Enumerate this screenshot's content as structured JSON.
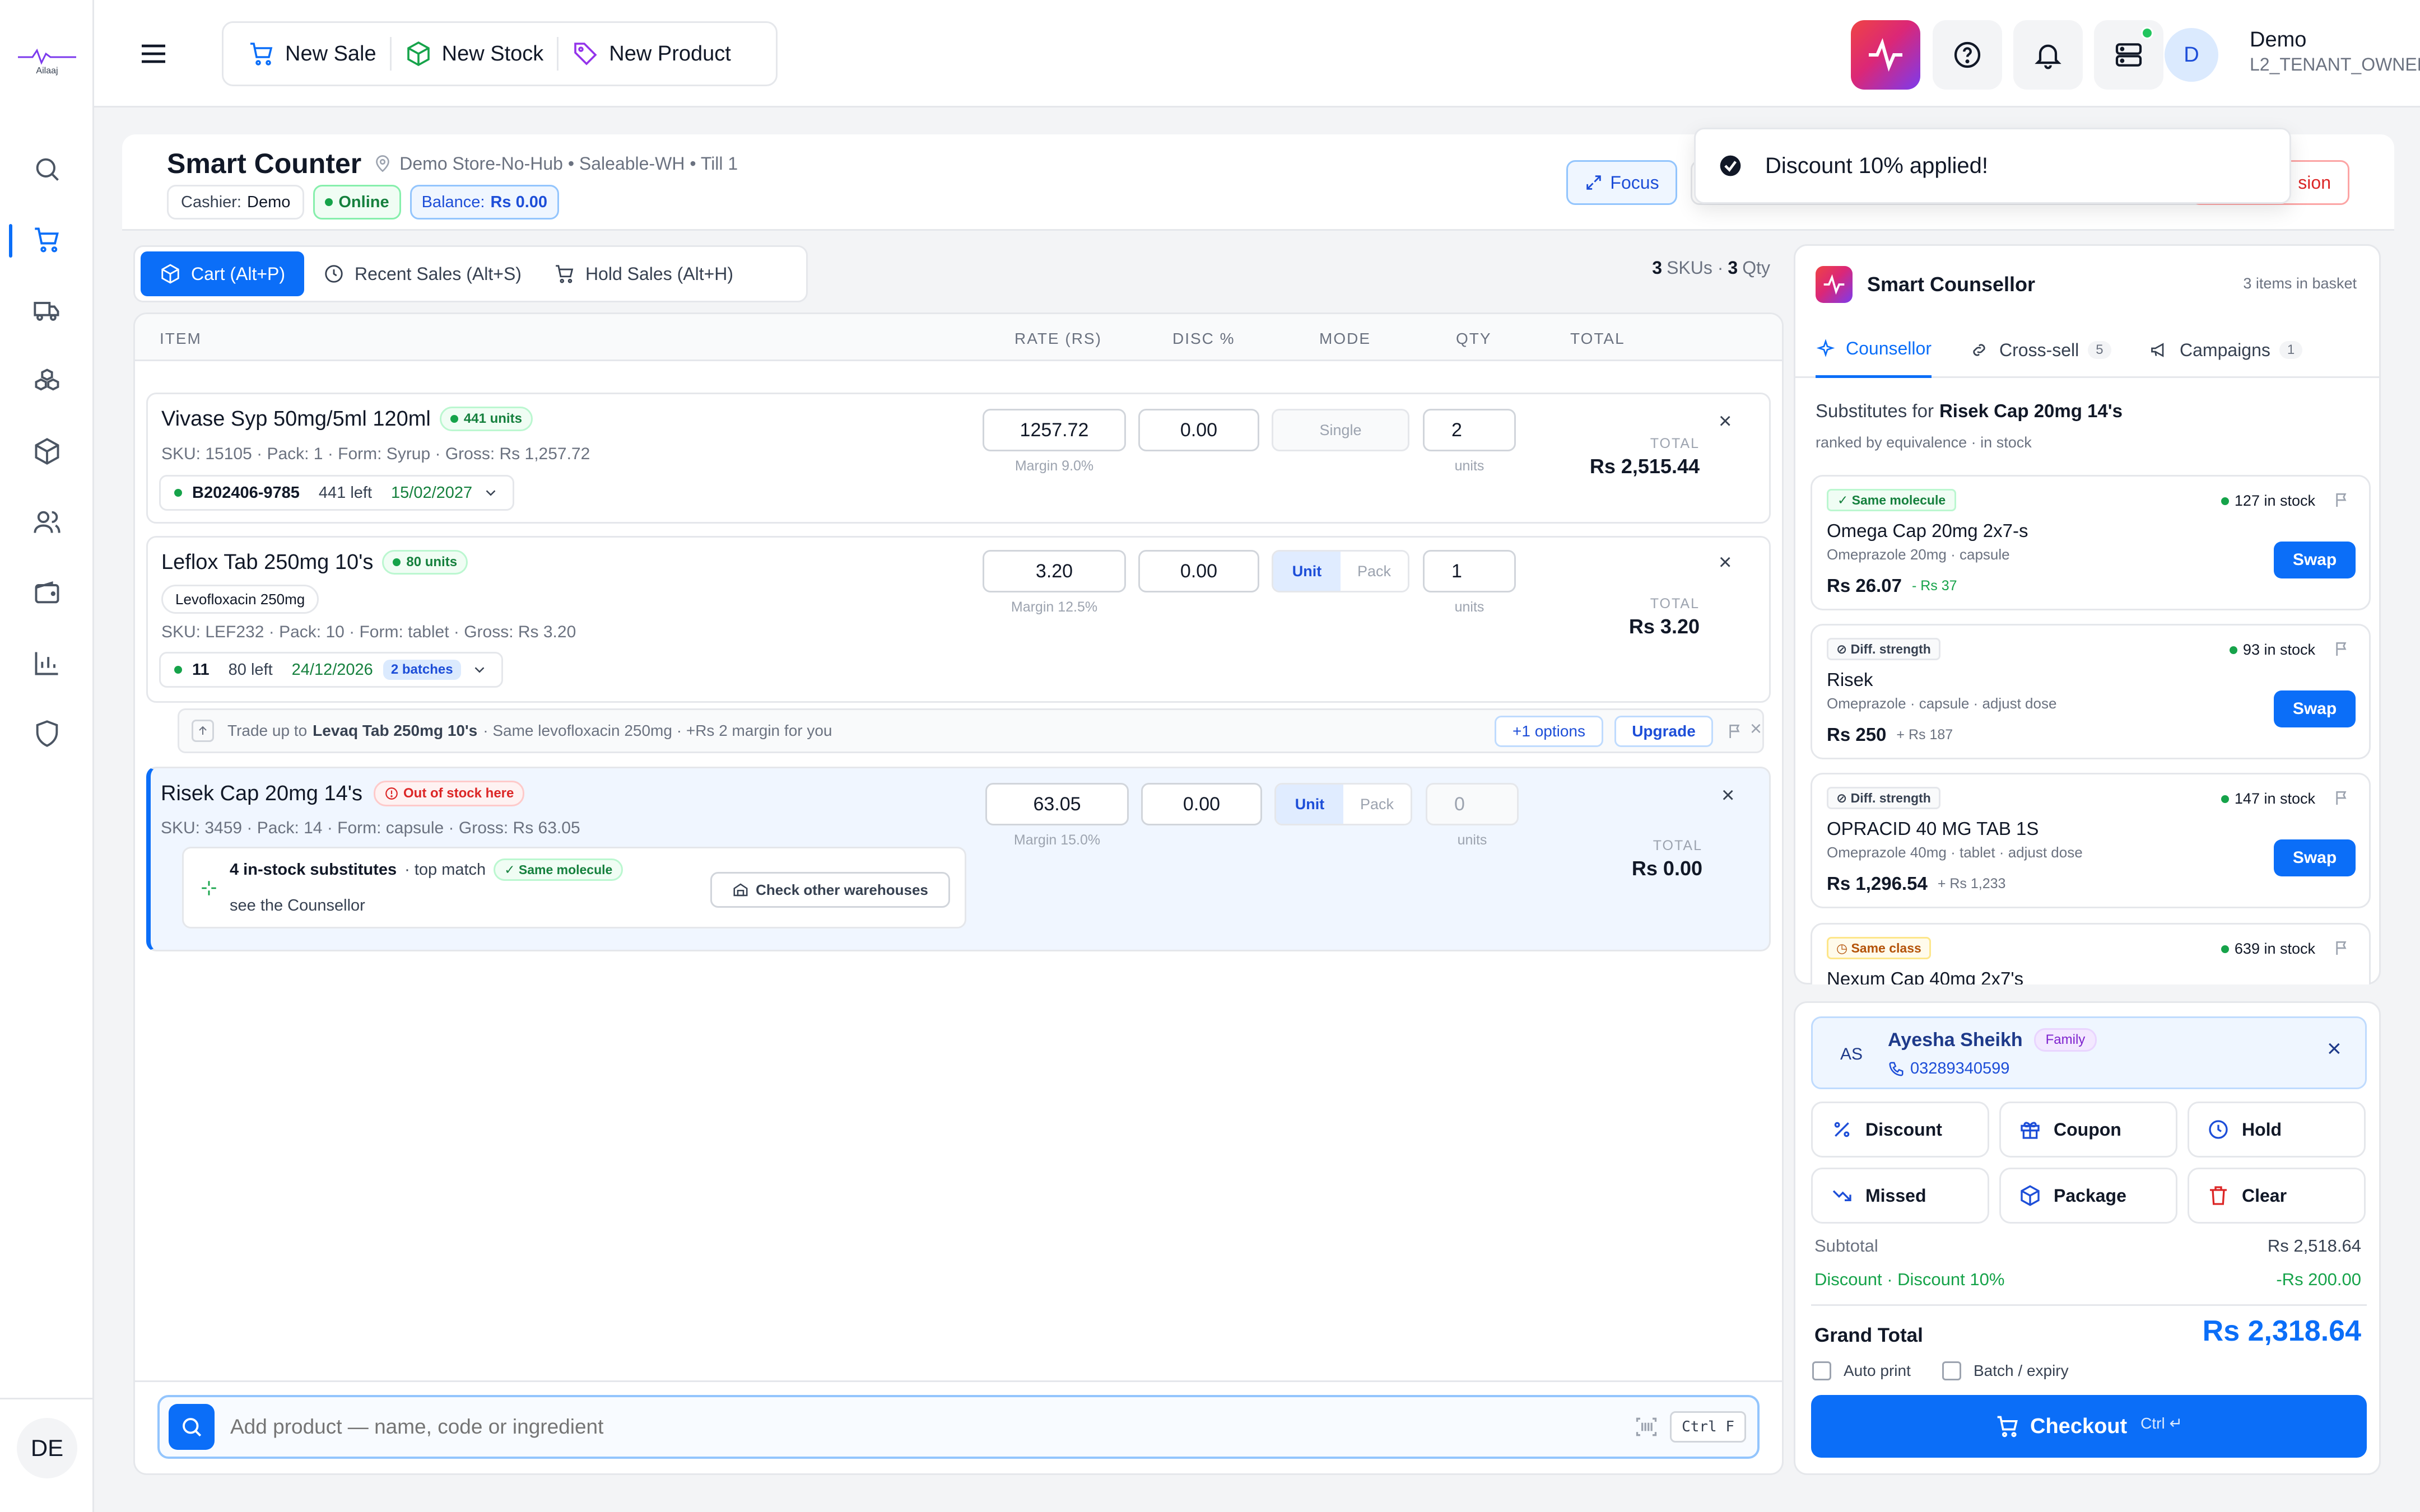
{
  "app": {
    "logo_text": "Ailaaj",
    "user_initials": "DE"
  },
  "header": {
    "new_sale": "New Sale",
    "new_stock": "New Stock",
    "new_product": "New Product",
    "user_name": "Demo",
    "user_role": "L2_TENANT_OWNER",
    "avatar_letter": "D"
  },
  "page": {
    "title": "Smart Counter",
    "location": "Demo Store-No-Hub • Saleable-WH • Till 1",
    "cashier_label": "Cashier:",
    "cashier": "Demo",
    "status": "Online",
    "balance_label": "Balance:",
    "balance": "Rs 0.00",
    "focus": "Focus",
    "session_partial": "sion"
  },
  "toast": {
    "text": "Discount 10% applied!"
  },
  "tabs": [
    {
      "label": "Cart (Alt+P)"
    },
    {
      "label": "Recent Sales (Alt+S)"
    },
    {
      "label": "Hold Sales (Alt+H)"
    }
  ],
  "cart_summary": {
    "skus": "3",
    "skus_label": "SKUs ·",
    "qty": "3",
    "qty_label": "Qty"
  },
  "columns": {
    "item": "ITEM",
    "rate": "RATE (RS)",
    "disc": "DISC %",
    "mode": "MODE",
    "qty": "QTY",
    "total": "TOTAL"
  },
  "items": [
    {
      "name": "Vivase Syp 50mg/5ml 120ml",
      "units_badge": "441 units",
      "meta": "SKU: 15105 · Pack: 1 · Form: Syrup · Gross: Rs 1,257.72",
      "batch": "B202406-9785",
      "left": "441 left",
      "expiry": "15/02/2027",
      "rate": "1257.72",
      "margin": "Margin 9.0%",
      "disc": "0.00",
      "mode": "Single",
      "qty": "2",
      "units_label": "units",
      "total_label": "TOTAL",
      "total": "Rs 2,515.44"
    },
    {
      "name": "Leflox Tab 250mg 10's",
      "units_badge": "80 units",
      "ingredient": "Levofloxacin 250mg",
      "meta": "SKU: LEF232 · Pack: 10 · Form: tablet · Gross: Rs 3.20",
      "batch": "11",
      "left": "80 left",
      "expiry": "24/12/2026",
      "batches": "2 batches",
      "rate": "3.20",
      "margin": "Margin 12.5%",
      "disc": "0.00",
      "mode_unit": "Unit",
      "mode_pack": "Pack",
      "qty": "1",
      "units_label": "units",
      "total_label": "TOTAL",
      "total": "Rs 3.20",
      "upsell": {
        "prefix": "Trade up to",
        "product": "Levaq Tab 250mg 10's",
        "suffix": "· Same levofloxacin 250mg · +Rs 2 margin for you",
        "options": "+1 options",
        "upgrade": "Upgrade"
      }
    },
    {
      "name": "Risek Cap 20mg 14's",
      "oos_badge": "Out of stock here",
      "meta": "SKU: 3459 · Pack: 14 · Form: capsule · Gross: Rs 63.05",
      "rate": "63.05",
      "margin": "Margin 15.0%",
      "disc": "0.00",
      "mode_unit": "Unit",
      "mode_pack": "Pack",
      "qty": "0",
      "units_label": "units",
      "total_label": "TOTAL",
      "total": "Rs 0.00",
      "subs_title": "4 in-stock substitutes",
      "subs_match": "· top match",
      "subs_badge": "Same molecule",
      "subs_line2": "see the Counsellor",
      "check_wh": "Check other warehouses"
    }
  ],
  "search": {
    "placeholder": "Add product — name, code or ingredient",
    "shortcut": "Ctrl F"
  },
  "counsellor": {
    "title": "Smart Counsellor",
    "basket": "3 items in basket",
    "tab_counsellor": "Counsellor",
    "tab_cross": "Cross-sell",
    "cross_count": "5",
    "tab_campaigns": "Campaigns",
    "campaigns_count": "1",
    "subs_prefix": "Substitutes for",
    "subs_for": "Risek Cap 20mg 14's",
    "subs_hint": "ranked by equivalence · in stock",
    "swap_label": "Swap",
    "substitutes": [
      {
        "badge": "Same molecule",
        "stock": "127 in stock",
        "name": "Omega Cap 20mg 2x7-s",
        "desc": "Omeprazole 20mg · capsule",
        "price": "Rs 26.07",
        "delta": "- Rs 37"
      },
      {
        "badge": "Diff. strength",
        "stock": "93 in stock",
        "name": "Risek",
        "desc": "Omeprazole · capsule · adjust dose",
        "price": "Rs 250",
        "delta": "+ Rs 187"
      },
      {
        "badge": "Diff. strength",
        "stock": "147 in stock",
        "name": "OPRACID 40 MG TAB 1S",
        "desc": "Omeprazole 40mg · tablet · adjust dose",
        "price": "Rs 1,296.54",
        "delta": "+ Rs 1,233"
      },
      {
        "badge": "Same class",
        "stock": "639 in stock",
        "name": "Nexum Cap 40mg 2x7's"
      }
    ]
  },
  "customer": {
    "initials": "AS",
    "name": "Ayesha Sheikh",
    "tag": "Family",
    "phone": "03289340599"
  },
  "actions": {
    "discount": "Discount",
    "coupon": "Coupon",
    "hold": "Hold",
    "missed": "Missed",
    "package": "Package",
    "clear": "Clear"
  },
  "totals": {
    "subtotal_label": "Subtotal",
    "subtotal": "Rs 2,518.64",
    "discount_label": "Discount · Discount 10%",
    "discount": "-Rs 200.00",
    "grand_label": "Grand Total",
    "grand": "Rs 2,318.64",
    "auto_print": "Auto print",
    "batch_expiry": "Batch / expiry",
    "checkout": "Checkout",
    "checkout_hint": "Ctrl ↵"
  },
  "colors": {
    "primary": "#0b6ef8",
    "success": "#16a34a",
    "danger": "#dc2626",
    "accent_purple": "#7c3aed"
  }
}
